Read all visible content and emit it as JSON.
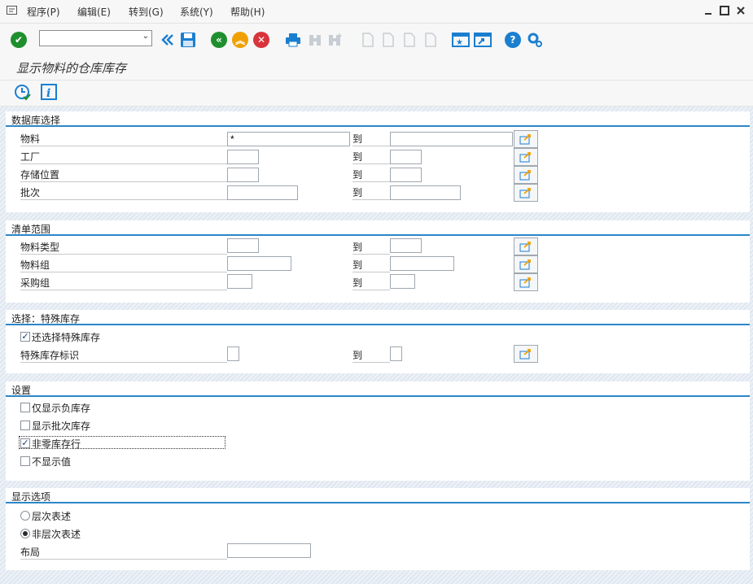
{
  "menu": {
    "items": [
      "程序(P)",
      "编辑(E)",
      "转到(G)",
      "系统(Y)",
      "帮助(H)"
    ]
  },
  "toolbar": {
    "command_field_value": "",
    "icons": [
      "enter-icon",
      "back-double-icon",
      "save-icon",
      "back-icon",
      "exit-icon",
      "cancel-icon",
      "print-icon",
      "find-icon",
      "find-next-icon",
      "first-page-icon",
      "prev-page-icon",
      "next-page-icon",
      "last-page-icon",
      "new-session-icon",
      "shortcut-icon",
      "help-icon",
      "settings-icon"
    ]
  },
  "title": "显示物料的仓库库存",
  "app_toolbar": {
    "icons": [
      "execute-clock-icon",
      "info-icon"
    ]
  },
  "sections": {
    "database": {
      "title": "数据库选择",
      "rows": [
        {
          "label": "物料",
          "low": "*",
          "to": "到",
          "high": ""
        },
        {
          "label": "工厂",
          "low": "",
          "to": "到",
          "high": ""
        },
        {
          "label": "存储位置",
          "low": "",
          "to": "到",
          "high": ""
        },
        {
          "label": "批次",
          "low": "",
          "to": "到",
          "high": ""
        }
      ]
    },
    "list_scope": {
      "title": "清单范围",
      "rows": [
        {
          "label": "物料类型",
          "low": "",
          "to": "到",
          "high": ""
        },
        {
          "label": "物料组",
          "low": "",
          "to": "到",
          "high": ""
        },
        {
          "label": "采购组",
          "low": "",
          "to": "到",
          "high": ""
        }
      ]
    },
    "special_stock": {
      "title": "选择：特殊库存",
      "checkbox_label": "还选择特殊库存",
      "checkbox_checked": true,
      "row": {
        "label": "特殊库存标识",
        "low": "",
        "to": "到",
        "high": ""
      }
    },
    "settings": {
      "title": "设置",
      "options": [
        {
          "label": "仅显示负库存",
          "checked": false
        },
        {
          "label": "显示批次库存",
          "checked": false
        },
        {
          "label": "非零库存行",
          "checked": true
        },
        {
          "label": "不显示值",
          "checked": false
        }
      ]
    },
    "display": {
      "title": "显示选项",
      "radios": [
        {
          "label": "层次表述",
          "selected": false
        },
        {
          "label": "非层次表述",
          "selected": true
        }
      ],
      "layout_label": "布局",
      "layout_value": ""
    }
  },
  "colors": {
    "accent_line": "#2b87c8",
    "enter_green": "#1f8f2e",
    "exit_orange": "#f0a000",
    "cancel_red": "#d8343b",
    "help_blue": "#1b7fd0"
  }
}
